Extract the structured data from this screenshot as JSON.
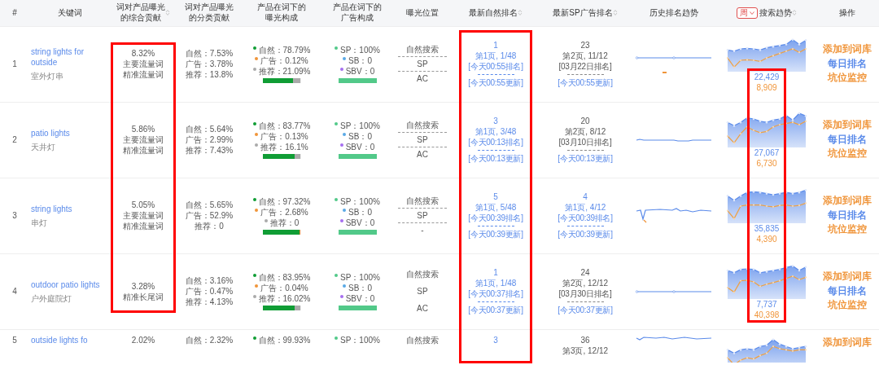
{
  "table": {
    "columns": [
      {
        "label_lines": [
          "#"
        ]
      },
      {
        "label_lines": [
          "关键词"
        ]
      },
      {
        "label_lines": [
          "词对产品曝光",
          "的综合贡献"
        ],
        "sortable": true,
        "highlighted": true
      },
      {
        "label_lines": [
          "词对产品曝光",
          "的分类贡献"
        ]
      },
      {
        "label_lines": [
          "产品在词下的",
          "曝光构成"
        ]
      },
      {
        "label_lines": [
          "产品在词下的",
          "广告构成"
        ]
      },
      {
        "label_lines": [
          "曝光位置"
        ]
      },
      {
        "label_lines": [
          "最新自然排名"
        ],
        "sortable": true,
        "highlighted": true
      },
      {
        "label_lines": [
          "最新SP广告排名"
        ],
        "sortable": true
      },
      {
        "label_lines": [
          "历史排名趋势"
        ]
      },
      {
        "label_lines": [
          "搜索趋势"
        ],
        "sortable": true,
        "highlighted": true,
        "period": "周"
      },
      {
        "label_lines": [
          "操作"
        ]
      }
    ],
    "rows": [
      {
        "index": "1",
        "keyword": "string lights for outside",
        "keyword_cn": "室外灯串",
        "share": "8.32%",
        "tags": [
          "主要流量词",
          "精准流量词"
        ],
        "category": [
          "自然：7.53%",
          "广告：3.78%",
          "推荐：13.8%"
        ],
        "exposure": [
          {
            "text": "自然：78.79%",
            "color": "#109d35"
          },
          {
            "text": "广告：0.12%",
            "color": "#f0953a"
          },
          {
            "text": "推荐：21.09%",
            "color": "#aaaaaa"
          }
        ],
        "exposure_bar": [
          {
            "level": 0.79,
            "color": "#109d35"
          },
          {
            "level": 0.21,
            "color": "#aaaaaa"
          }
        ],
        "ads": [
          {
            "text": "SP：100%",
            "color": "#52c989"
          },
          {
            "text": "SB：0",
            "color": "#5aa9e6"
          },
          {
            "text": "SBV：0",
            "color": "#a66ef0"
          }
        ],
        "ad_bar": {
          "level": 1
        },
        "position": [
          "自然搜索",
          "SP",
          "AC"
        ],
        "position_dividers": true,
        "natural_rank": {
          "rank": "1",
          "page": "第1页, 1/48",
          "ranked": "[今天00:55排名]",
          "updated": "[今天00:55更新]"
        },
        "sp_rank": {
          "current": false,
          "rank": "23",
          "page": "第2页, 11/12",
          "ranked": "[03月22日排名]",
          "updated": "[今天00:55更新]"
        },
        "trend_values": [
          "22,429",
          "8,909"
        ],
        "ops": [
          {
            "label": "添加到词库",
            "color": "#f0953a"
          },
          {
            "label": "每日排名",
            "color": "#5b8bea"
          },
          {
            "label": "坑位监控",
            "color": "#f0953a"
          }
        ]
      },
      {
        "index": "2",
        "keyword": "patio lights",
        "keyword_cn": "天井灯",
        "share": "5.86%",
        "tags": [
          "主要流量词",
          "精准流量词"
        ],
        "category": [
          "自然：5.64%",
          "广告：2.99%",
          "推荐：7.43%"
        ],
        "exposure": [
          {
            "text": "自然：83.77%",
            "color": "#109d35"
          },
          {
            "text": "广告：0.13%",
            "color": "#f0953a"
          },
          {
            "text": "推荐：16.1%",
            "color": "#aaaaaa"
          }
        ],
        "exposure_bar": [
          {
            "level": 0.84,
            "color": "#109d35"
          },
          {
            "level": 0.16,
            "color": "#aaaaaa"
          }
        ],
        "ads": [
          {
            "text": "SP：100%",
            "color": "#52c989"
          },
          {
            "text": "SB：0",
            "color": "#5aa9e6"
          },
          {
            "text": "SBV：0",
            "color": "#a66ef0"
          }
        ],
        "ad_bar": {
          "level": 1
        },
        "position": [
          "自然搜索",
          "SP",
          "AC"
        ],
        "position_dividers": true,
        "natural_rank": {
          "rank": "3",
          "page": "第1页, 3/48",
          "ranked": "[今天00:13排名]",
          "updated": "[今天00:13更新]"
        },
        "sp_rank": {
          "current": false,
          "rank": "20",
          "page": "第2页, 8/12",
          "ranked": "[03月10日排名]",
          "updated": "[今天00:13更新]"
        },
        "trend_values": [
          "27,067",
          "6,730"
        ],
        "ops": [
          {
            "label": "添加到词库",
            "color": "#f0953a"
          },
          {
            "label": "每日排名",
            "color": "#5b8bea"
          },
          {
            "label": "坑位监控",
            "color": "#f0953a"
          }
        ]
      },
      {
        "index": "3",
        "keyword": "string lights",
        "keyword_cn": "串灯",
        "share": "5.05%",
        "tags": [
          "主要流量词",
          "精准流量词"
        ],
        "category": [
          "自然：5.65%",
          "广告：52.9%",
          "推荐：0"
        ],
        "exposure": [
          {
            "text": "自然：97.32%",
            "color": "#109d35"
          },
          {
            "text": "广告：2.68%",
            "color": "#f0953a"
          },
          {
            "text": "推荐：0",
            "color": "#aaaaaa"
          }
        ],
        "exposure_bar": [
          {
            "level": 0.97,
            "color": "#109d35"
          },
          {
            "level": 0.03,
            "color": "#f0953a"
          }
        ],
        "ads": [
          {
            "text": "SP：100%",
            "color": "#52c989"
          },
          {
            "text": "SB：0",
            "color": "#5aa9e6"
          },
          {
            "text": "SBV：0",
            "color": "#a66ef0"
          }
        ],
        "ad_bar": {
          "level": 1
        },
        "position": [
          "自然搜索",
          "SP",
          "-"
        ],
        "position_dividers": true,
        "natural_rank": {
          "rank": "5",
          "page": "第1页, 5/48",
          "ranked": "[今天00:39排名]",
          "updated": "[今天00:39更新]"
        },
        "sp_rank": {
          "current": true,
          "rank": "4",
          "page": "第1页, 4/12",
          "ranked": "[今天00:39排名]",
          "updated": "[今天00:39更新]"
        },
        "trend_values": [
          "35,835",
          "4,390"
        ],
        "ops": [
          {
            "label": "添加到词库",
            "color": "#f0953a"
          },
          {
            "label": "每日排名",
            "color": "#5b8bea"
          },
          {
            "label": "坑位监控",
            "color": "#f0953a"
          }
        ]
      },
      {
        "index": "4",
        "keyword": "outdoor patio lights",
        "keyword_cn": "户外庭院灯",
        "share": "3.28%",
        "tags": [
          "精准长尾词"
        ],
        "category": [
          "自然：3.16%",
          "广告：0.47%",
          "推荐：4.13%"
        ],
        "exposure": [
          {
            "text": "自然：83.95%",
            "color": "#109d35"
          },
          {
            "text": "广告：0.04%",
            "color": "#f0953a"
          },
          {
            "text": "推荐：16.02%",
            "color": "#aaaaaa"
          }
        ],
        "exposure_bar": [
          {
            "level": 0.84,
            "color": "#109d35"
          },
          {
            "level": 0.16,
            "color": "#aaaaaa"
          }
        ],
        "ads": [
          {
            "text": "SP：100%",
            "color": "#52c989"
          },
          {
            "text": "SB：0",
            "color": "#5aa9e6"
          },
          {
            "text": "SBV：0",
            "color": "#a66ef0"
          }
        ],
        "ad_bar": {
          "level": 1
        },
        "position": [
          "自然搜索",
          "SP",
          "AC"
        ],
        "position_dividers": false,
        "natural_rank": {
          "rank": "1",
          "page": "第1页, 1/48",
          "ranked": "[今天00:37排名]",
          "updated": "[今天00:37更新]"
        },
        "sp_rank": {
          "current": false,
          "rank": "24",
          "page": "第2页, 12/12",
          "ranked": "[03月30日排名]",
          "updated": "[今天00:37更新]"
        },
        "trend_values": [
          "7,737",
          "40,398"
        ],
        "ops": [
          {
            "label": "添加到词库",
            "color": "#f0953a"
          },
          {
            "label": "每日排名",
            "color": "#5b8bea"
          },
          {
            "label": "坑位监控",
            "color": "#f0953a"
          }
        ]
      },
      {
        "index": "5",
        "keyword": "outside lights fo",
        "share": "2.02%",
        "category": [
          "自然：2.32%"
        ],
        "exposure": [
          {
            "text": "自然：99.93%",
            "color": "#109d35"
          }
        ],
        "ads": [
          {
            "text": "SP：100%",
            "color": "#52c989"
          }
        ],
        "position": [
          "自然搜索"
        ],
        "natural_rank": {
          "rank": "3"
        },
        "sp_rank": {
          "current": false,
          "rank": "36",
          "page": "第3页, 12/12"
        },
        "ops": [
          {
            "label": "添加到词库",
            "color": "#f0953a"
          }
        ]
      }
    ]
  }
}
